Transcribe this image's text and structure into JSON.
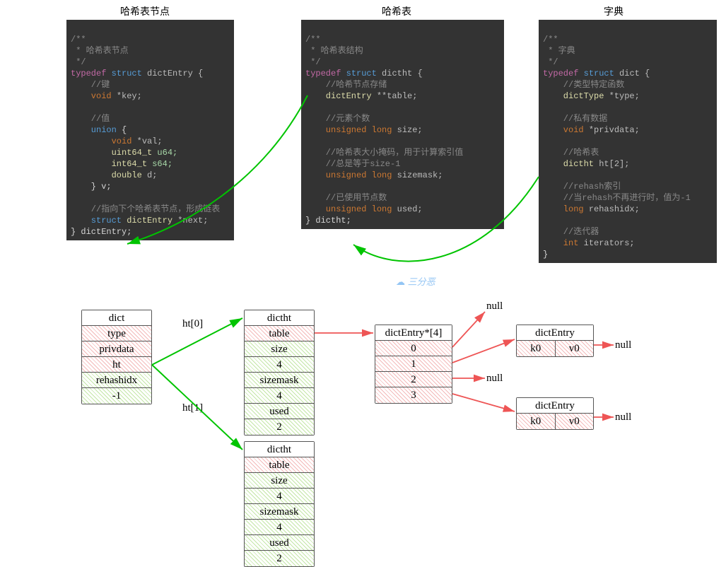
{
  "titles": {
    "entry": "哈希表节点",
    "dictht": "哈希表",
    "dict": "字典"
  },
  "code_entry": {
    "c0": "/**",
    "c1": " * 哈希表节点",
    "c2": " */",
    "l0a": "typedef",
    "l0b": "struct",
    "l0c": "dictEntry {",
    "l1_c": "    //键",
    "l2a": "    void",
    "l2b": "*key;",
    "l3_c": "    //值",
    "l4a": "    union",
    "l4b": "{",
    "l5a": "        void",
    "l5b": "*val;",
    "l6a": "        uint64_t",
    "l6b": "u64;",
    "l7a": "        int64_t",
    "l7b": "s64;",
    "l8a": "        double",
    "l8b": "d;",
    "l9": "    } v;",
    "l10_c": "    //指向下个哈希表节点，形成链表",
    "l11a": "    struct",
    "l11b": "dictEntry",
    "l11c": "*next;",
    "l12": "} dictEntry;"
  },
  "code_dictht": {
    "c0": "/**",
    "c1": " * 哈希表结构",
    "c2": " */",
    "l0a": "typedef",
    "l0b": "struct",
    "l0c": "dictht {",
    "l1_c": "    //哈希节点存储",
    "l2a": "    dictEntry",
    "l2b": "**table;",
    "l3_c": "    //元素个数",
    "l4a": "    unsigned long",
    "l4b": "size;",
    "l5_c": "    //哈希表大小掩码，用于计算索引值",
    "l6_c": "    //总是等于size-1",
    "l7a": "    unsigned long",
    "l7b": "sizemask;",
    "l8_c": "    //已使用节点数",
    "l9a": "    unsigned long",
    "l9b": "used;",
    "l10": "} dictht;"
  },
  "code_dict": {
    "c0": "/**",
    "c1": " * 字典",
    "c2": " */",
    "l0a": "typedef",
    "l0b": "struct",
    "l0c": "dict {",
    "l1_c": "    //类型特定函数",
    "l2a": "    dictType",
    "l2b": "*type;",
    "l3_c": "    //私有数据",
    "l4a": "    void",
    "l4b": "*privdata;",
    "l5_c": "    //哈希表",
    "l6a": "    dictht",
    "l6b": "ht[2];",
    "l7_c": "    //rehash索引",
    "l8_c": "    //当rehash不再进行时，值为-1",
    "l9a": "    long",
    "l9b": "rehashidx;",
    "l10_c": "    //迭代器",
    "l11a": "    int",
    "l11b": "iterators;",
    "l12": "}"
  },
  "watermark": "三分恶",
  "diagram": {
    "dict": {
      "h": "dict",
      "r0": "type",
      "r1": "privdata",
      "r2": "ht",
      "r3": "rehashidx",
      "r4": "-1"
    },
    "ht_label0": "ht[0]",
    "ht_label1": "ht[1]",
    "dictht": {
      "h": "dictht",
      "r0": "table",
      "r1": "size",
      "r2": "4",
      "r3": "sizemask",
      "r4": "4",
      "r5": "used",
      "r6": "2"
    },
    "entry_arr": {
      "h": "dictEntry*[4]",
      "r0": "0",
      "r1": "1",
      "r2": "2",
      "r3": "3"
    },
    "entry": {
      "h": "dictEntry",
      "k": "k0",
      "v": "v0"
    },
    "null": "null"
  }
}
